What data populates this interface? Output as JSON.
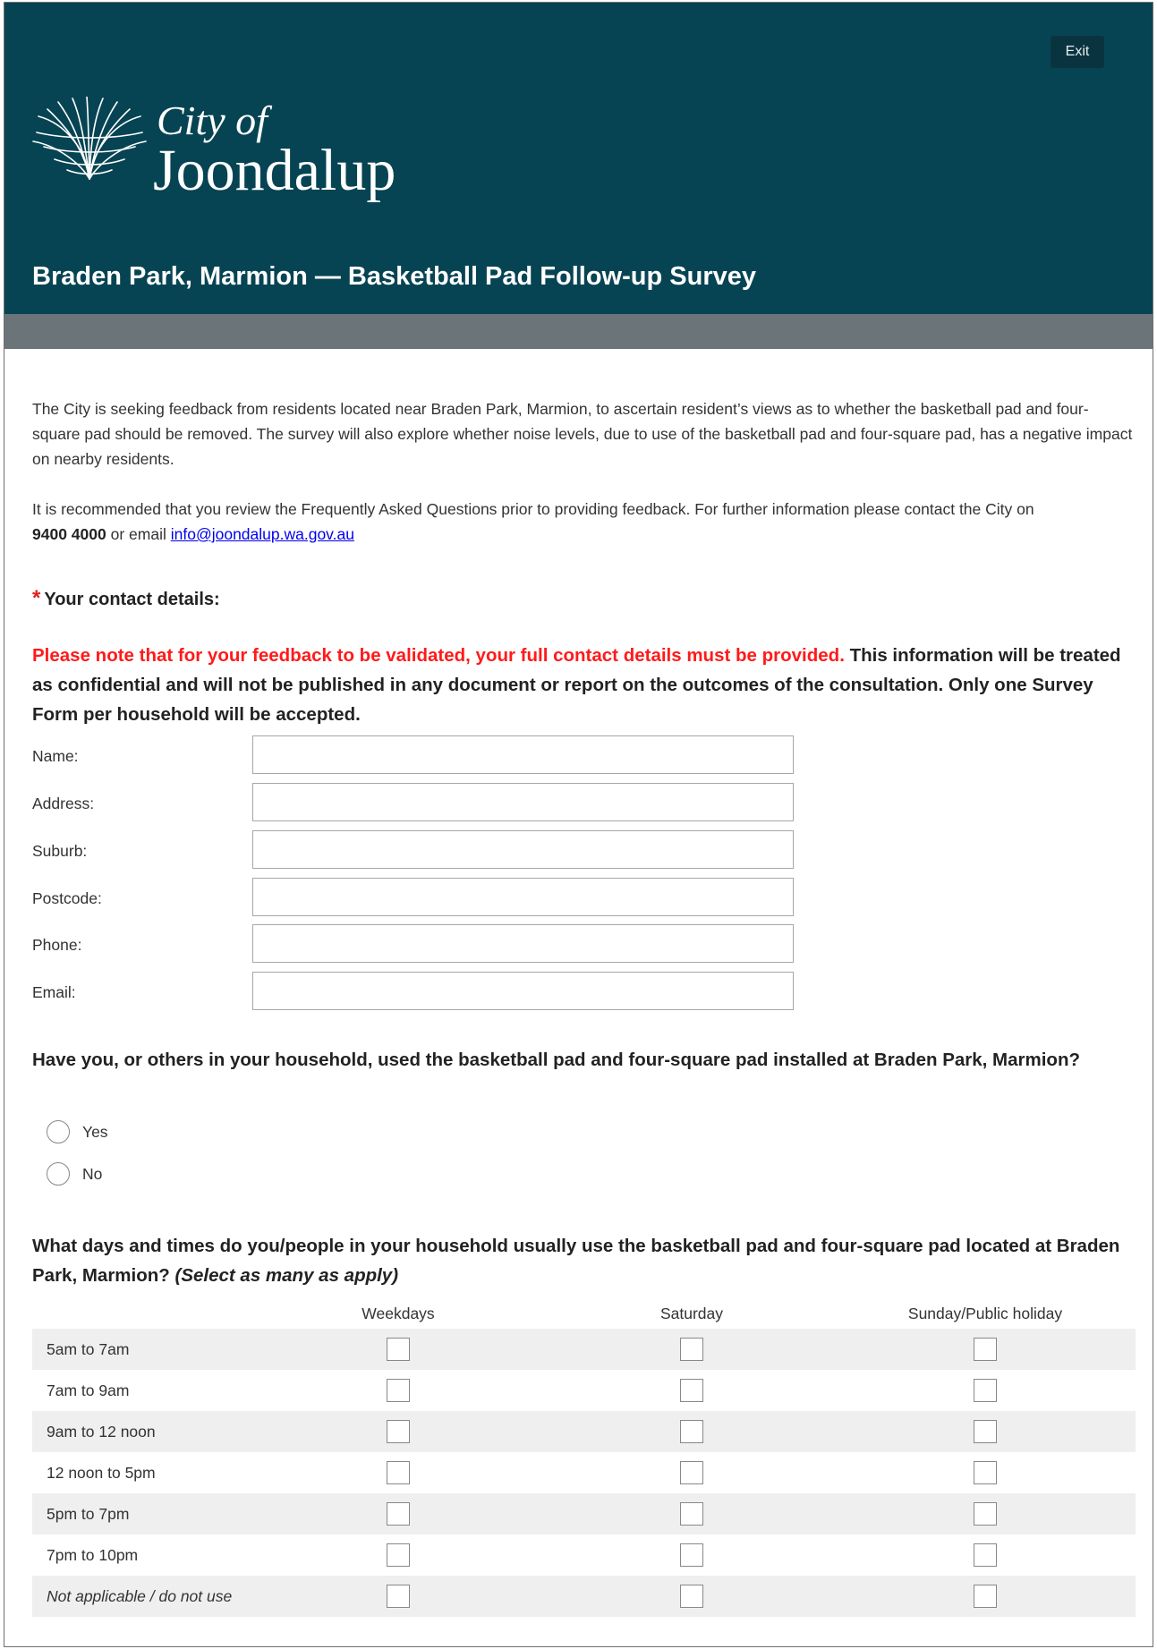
{
  "header": {
    "exit_label": "Exit",
    "logo": {
      "line1": "City of",
      "line2": "Joondalup"
    },
    "title": "Braden Park, Marmion — Basketball Pad Follow-up Survey",
    "background_color": "#074453"
  },
  "intro": {
    "paragraph1": "The City is seeking feedback from residents located near Braden Park, Marmion, to ascertain resident’s views as to whether the basketball pad and four-square pad should be removed. The survey will also explore whether noise levels, due to use of the basketball pad and four-square pad, has a negative impact on nearby residents.",
    "paragraph2_text": "It is recommended that you review the Frequently Asked Questions prior to providing feedback. For further information please contact the City on",
    "phone": "9400 4000",
    "email_prefix": "or email",
    "email": "info@joondalup.wa.gov.au"
  },
  "contact": {
    "asterisk": "*",
    "label": "Your contact details:",
    "note_red": "Please note that for your feedback to be validated, your full contact details must be provided.",
    "note_rest": "This information will be treated as confidential and will not be published in any document or report on the outcomes of the consultation. Only one Survey Form per household will be accepted.",
    "fields": [
      {
        "label": "Name:",
        "value": ""
      },
      {
        "label": "Address:",
        "value": ""
      },
      {
        "label": "Suburb:",
        "value": ""
      },
      {
        "label": "Postcode:",
        "value": ""
      },
      {
        "label": "Phone:",
        "value": ""
      },
      {
        "label": "Email:",
        "value": ""
      }
    ]
  },
  "q1": {
    "text": "Have you, or others in your household, used the basketball pad and four-square pad installed at Braden Park, Marmion?",
    "options": [
      {
        "label": "Yes",
        "selected": false
      },
      {
        "label": "No",
        "selected": false
      }
    ]
  },
  "q2": {
    "text": "What days and times do you/people in your household usually use the basketball pad and four-square pad located at Braden Park, Marmion?",
    "hint": "(Select as many as apply)",
    "columns": [
      "Weekdays",
      "Saturday",
      "Sunday/Public holiday"
    ],
    "rows": [
      {
        "label": "5am to 7am",
        "checked": [
          false,
          false,
          false
        ]
      },
      {
        "label": "7am to 9am",
        "checked": [
          false,
          false,
          false
        ]
      },
      {
        "label": "9am to 12 noon",
        "checked": [
          false,
          false,
          false
        ]
      },
      {
        "label": "12 noon to 5pm",
        "checked": [
          false,
          false,
          false
        ]
      },
      {
        "label": "5pm to 7pm",
        "checked": [
          false,
          false,
          false
        ]
      },
      {
        "label": "7pm to 10pm",
        "checked": [
          false,
          false,
          false
        ]
      },
      {
        "label": "Not applicable / do not use",
        "checked": [
          false,
          false,
          false
        ]
      }
    ]
  }
}
